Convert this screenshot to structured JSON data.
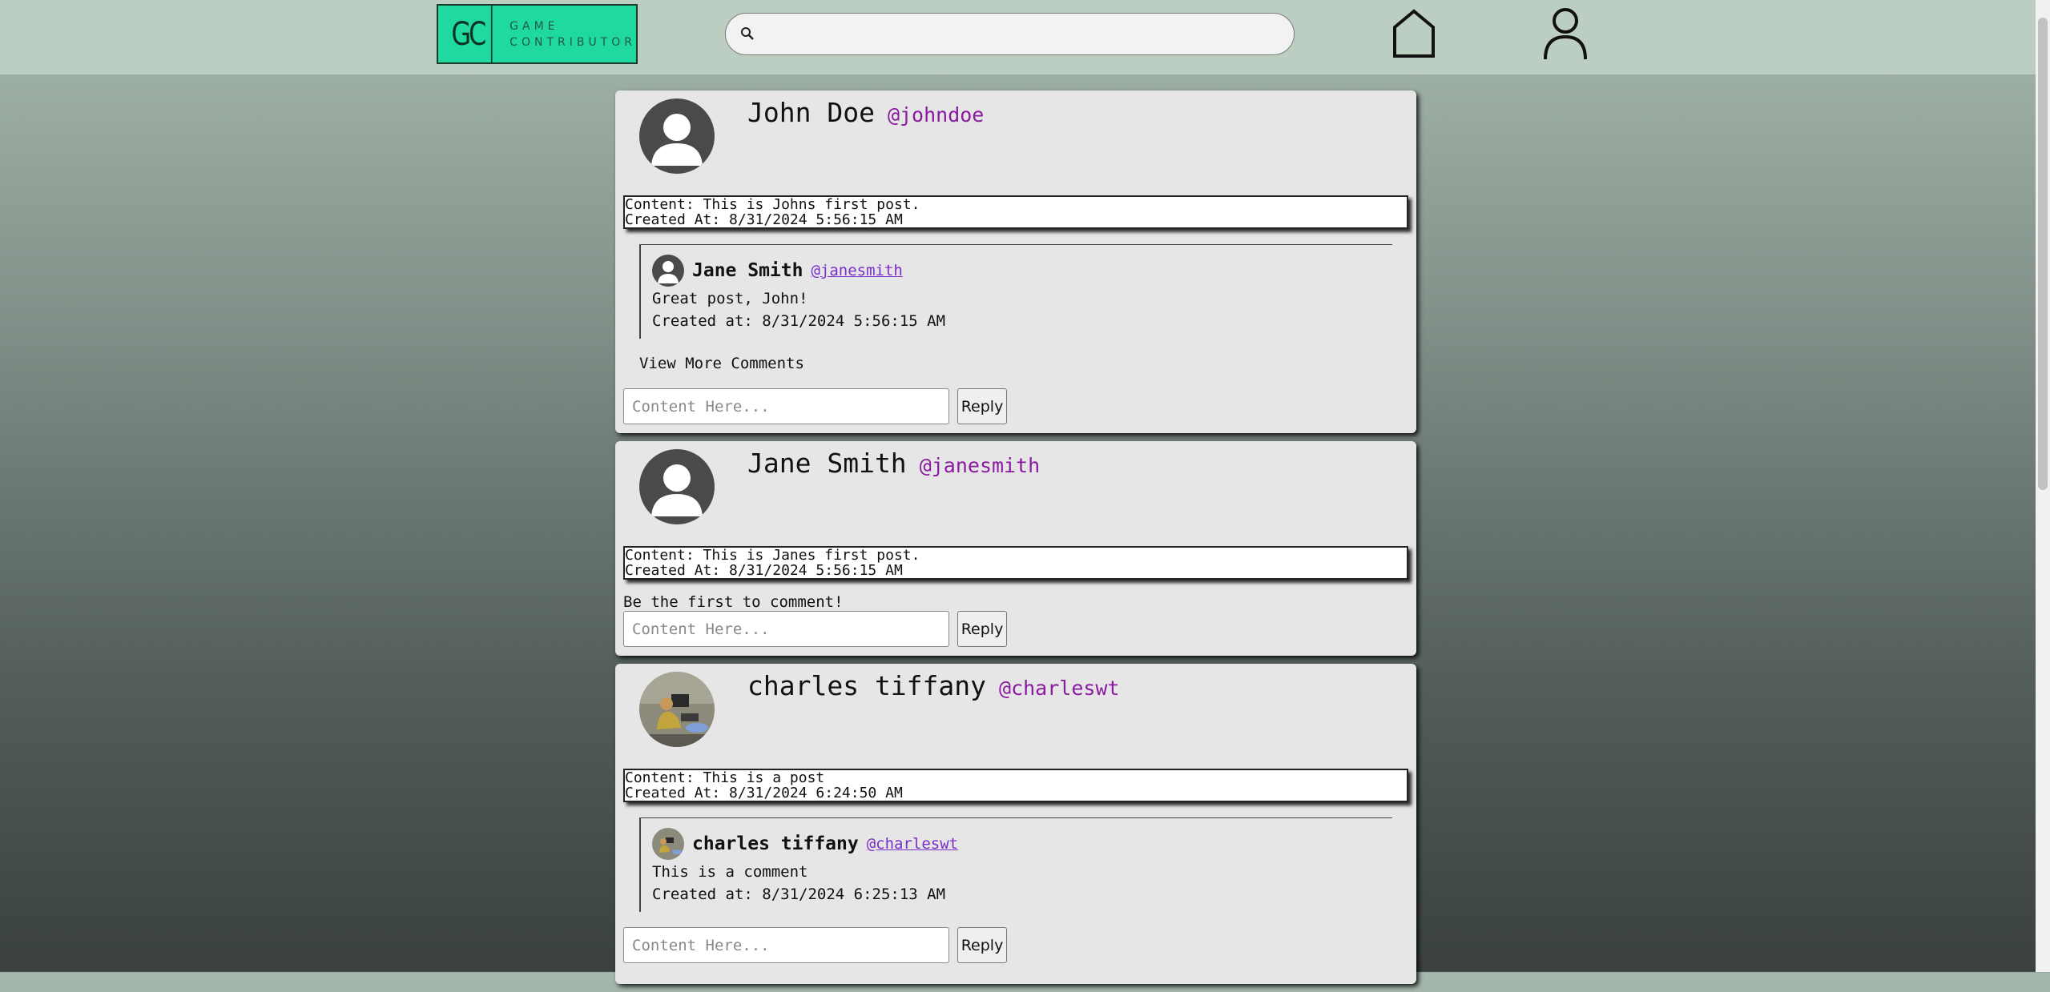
{
  "header": {
    "logo_mark": "GC",
    "logo_line1": "GAME",
    "logo_line2": "CONTRIBUTOR",
    "search_placeholder": "",
    "icons": [
      "search-icon",
      "home-icon",
      "user-icon"
    ]
  },
  "posts": [
    {
      "name": "John Doe",
      "handle": "@johndoe",
      "content": "Content: This is Johns first post.",
      "created": "Created At: 8/31/2024 5:56:15 AM",
      "comments": [
        {
          "name": "Jane Smith",
          "handle": "@janesmith",
          "text": "Great post, John!",
          "created": "Created at: 8/31/2024 5:56:15 AM"
        }
      ],
      "view_more": "View More Comments",
      "reply_placeholder": "Content Here...",
      "reply_label": "Reply"
    },
    {
      "name": "Jane Smith",
      "handle": "@janesmith",
      "content": "Content: This is Janes first post.",
      "created": "Created At: 8/31/2024 5:56:15 AM",
      "empty_comments": "Be the first to comment!",
      "reply_placeholder": "Content Here...",
      "reply_label": "Reply"
    },
    {
      "name": "charles tiffany",
      "handle": "@charleswt",
      "content": "Content: This is a post",
      "created": "Created At: 8/31/2024 6:24:50 AM",
      "comments": [
        {
          "name": "charles tiffany",
          "handle": "@charleswt",
          "text": "This is a comment",
          "created": "Created at: 8/31/2024 6:25:13 AM"
        }
      ],
      "reply_placeholder": "Content Here...",
      "reply_label": "Reply"
    }
  ],
  "colors": {
    "logo_bg": "#1fd9a0",
    "handle": "#8a1aa0",
    "comment_handle": "#7b2fc9",
    "topbar": "#bccdc1"
  }
}
